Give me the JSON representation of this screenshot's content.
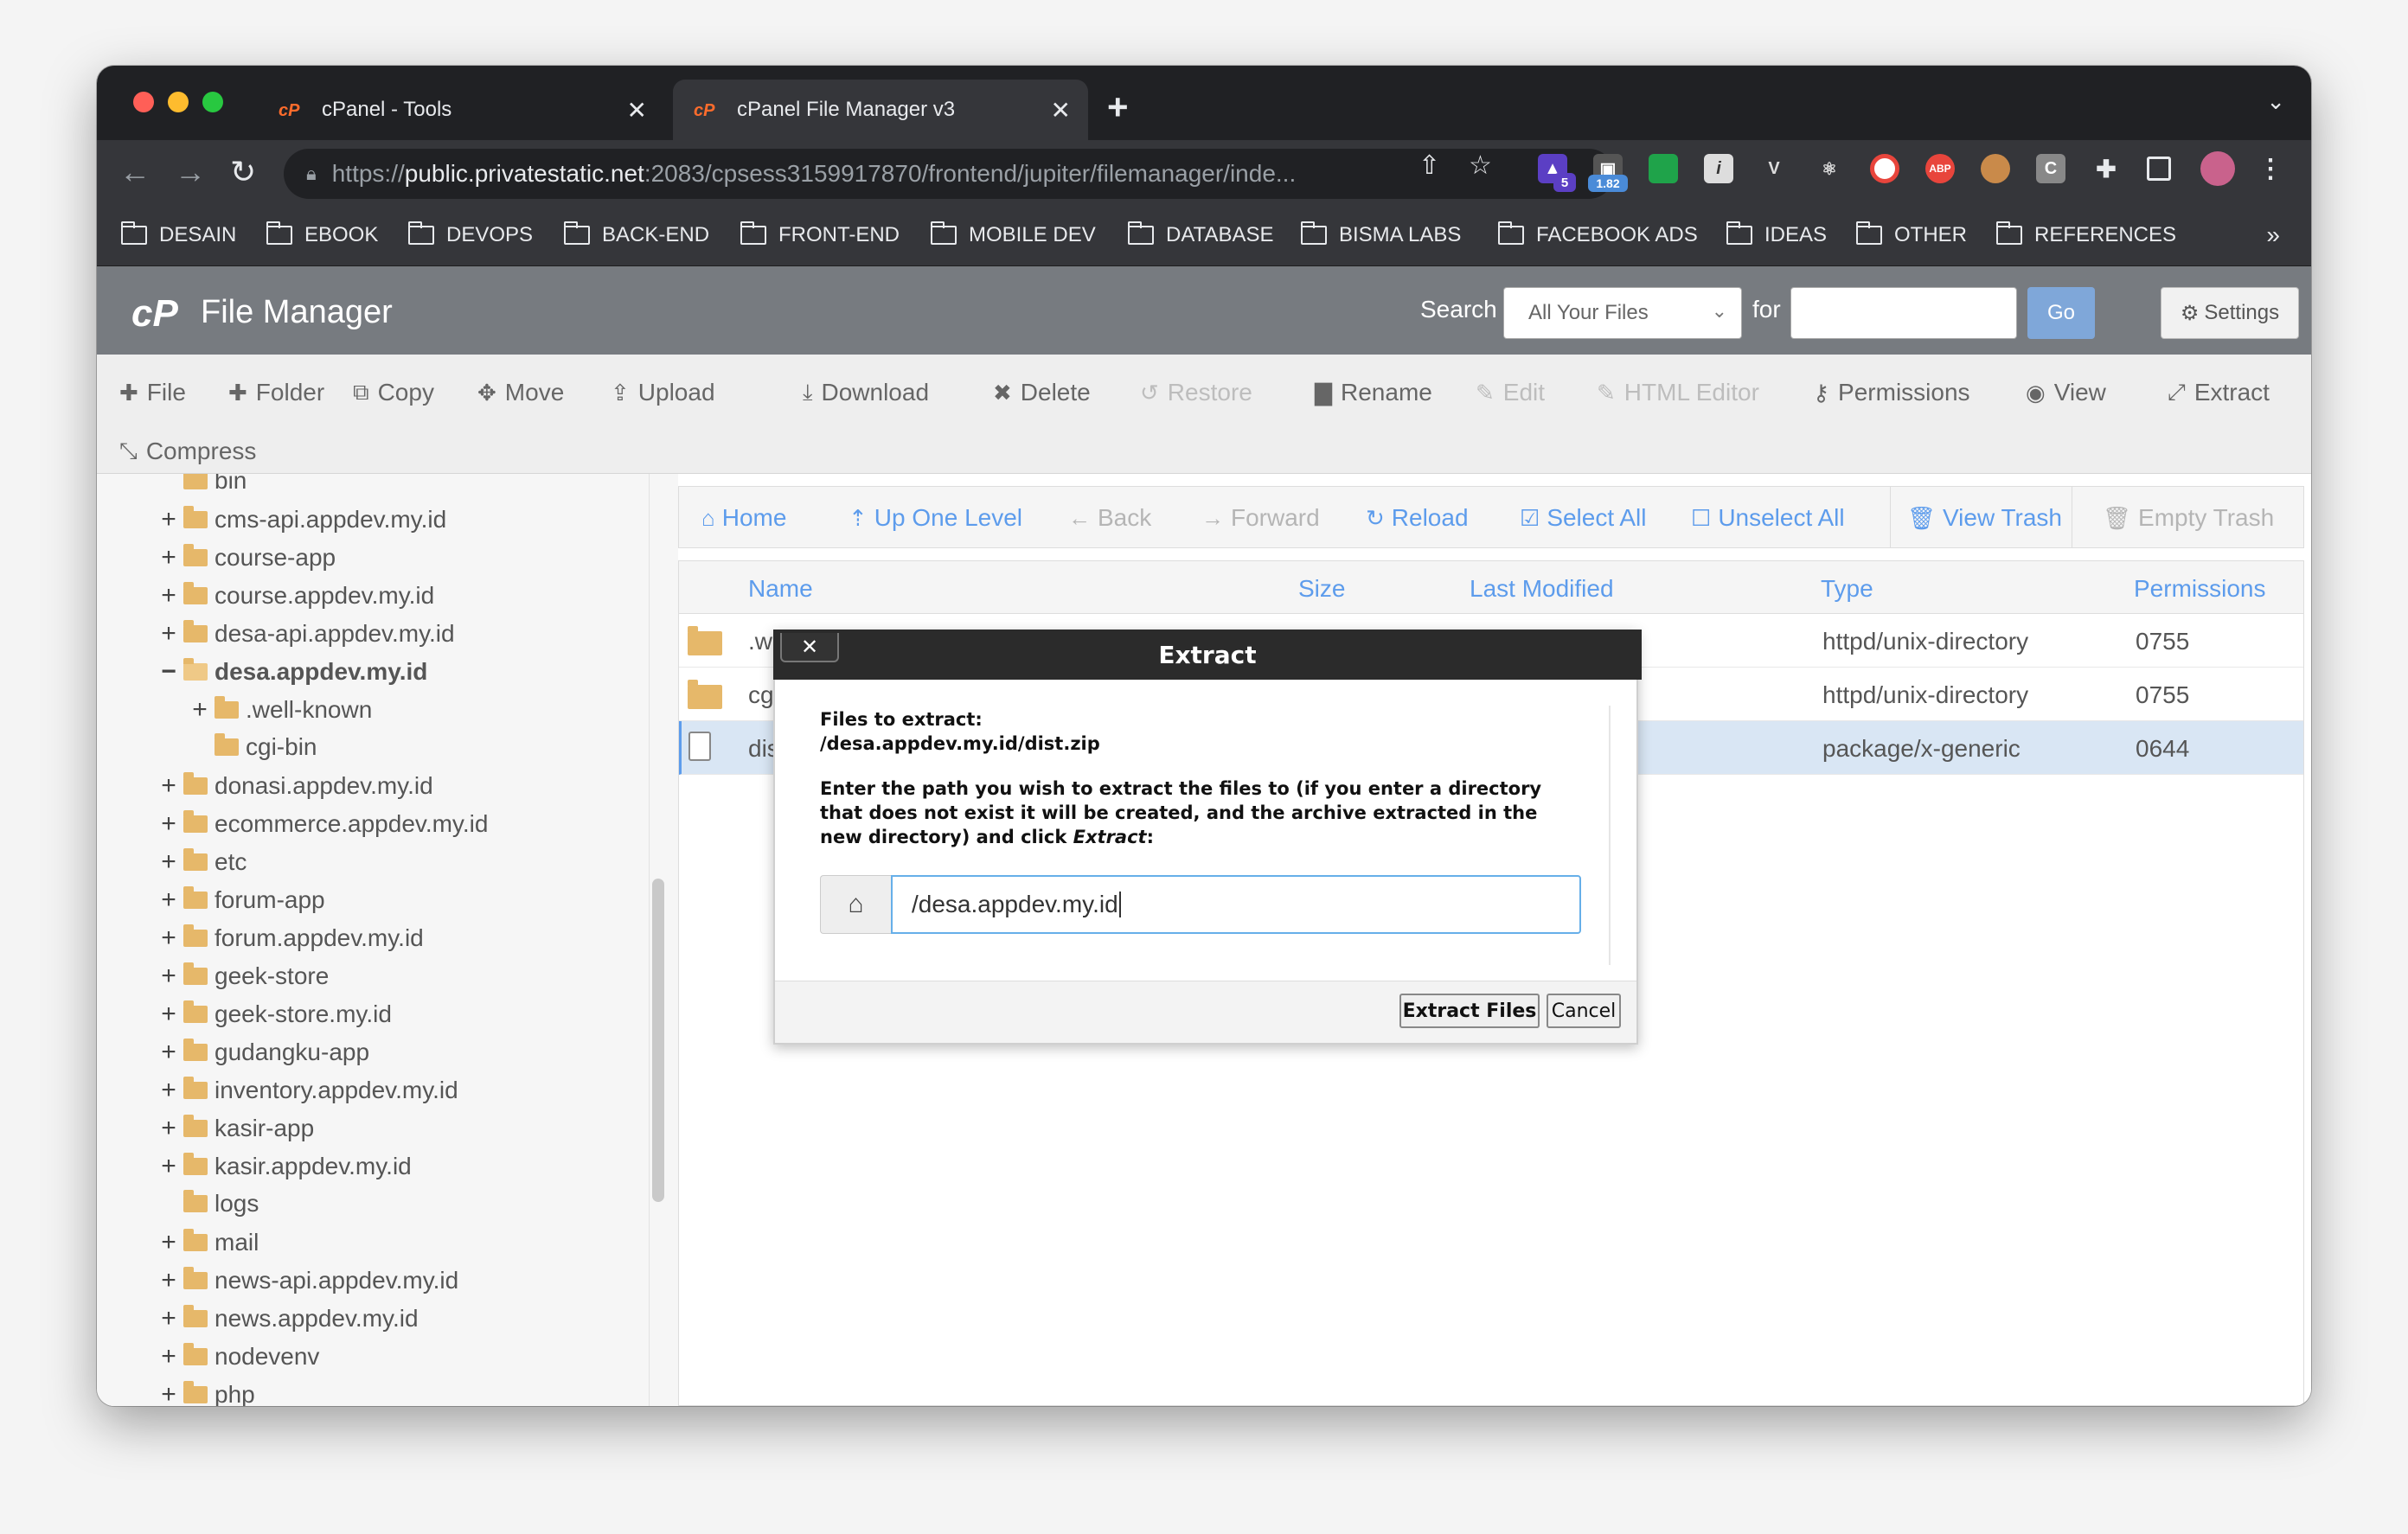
{
  "browser": {
    "tabs": [
      {
        "title": "cPanel - Tools",
        "active": false
      },
      {
        "title": "cPanel File Manager v3",
        "active": true
      }
    ],
    "url_prefix": "https://",
    "url_host": "public.privatestatic.net",
    "url_rest": ":2083/cpsess3159917870/frontend/jupiter/filemanager/inde...",
    "extension_badges": {
      "badge1": "5",
      "badge2": "1.82",
      "abp": "ABP",
      "c": "C"
    },
    "bookmarks": [
      "DESAIN",
      "EBOOK",
      "DEVOPS",
      "BACK-END",
      "FRONT-END",
      "MOBILE DEV",
      "DATABASE",
      "BISMA LABS",
      "FACEBOOK ADS",
      "IDEAS",
      "OTHER",
      "REFERENCES"
    ],
    "bookmarks_more": "»"
  },
  "cpanel": {
    "logo": "cP",
    "title": "File Manager",
    "search_label": "Search",
    "search_scope": "All Your Files",
    "for_label": "for",
    "go_label": "Go",
    "settings_label": "Settings"
  },
  "actions": {
    "file": "File",
    "folder": "Folder",
    "copy": "Copy",
    "move": "Move",
    "upload": "Upload",
    "download": "Download",
    "delete": "Delete",
    "restore": "Restore",
    "rename": "Rename",
    "edit": "Edit",
    "html_editor": "HTML Editor",
    "permissions": "Permissions",
    "view": "View",
    "extract": "Extract",
    "compress": "Compress"
  },
  "tree": [
    {
      "label": "bin",
      "expander": ""
    },
    {
      "label": "cms-api.appdev.my.id",
      "expander": "+"
    },
    {
      "label": "course-app",
      "expander": "+"
    },
    {
      "label": "course.appdev.my.id",
      "expander": "+"
    },
    {
      "label": "desa-api.appdev.my.id",
      "expander": "+"
    },
    {
      "label": "desa.appdev.my.id",
      "expander": "−"
    },
    {
      "label": ".well-known",
      "expander": "+"
    },
    {
      "label": "cgi-bin",
      "expander": ""
    },
    {
      "label": "donasi.appdev.my.id",
      "expander": "+"
    },
    {
      "label": "ecommerce.appdev.my.id",
      "expander": "+"
    },
    {
      "label": "etc",
      "expander": "+"
    },
    {
      "label": "forum-app",
      "expander": "+"
    },
    {
      "label": "forum.appdev.my.id",
      "expander": "+"
    },
    {
      "label": "geek-store",
      "expander": "+"
    },
    {
      "label": "geek-store.my.id",
      "expander": "+"
    },
    {
      "label": "gudangku-app",
      "expander": "+"
    },
    {
      "label": "inventory.appdev.my.id",
      "expander": "+"
    },
    {
      "label": "kasir-app",
      "expander": "+"
    },
    {
      "label": "kasir.appdev.my.id",
      "expander": "+"
    },
    {
      "label": "logs",
      "expander": ""
    },
    {
      "label": "mail",
      "expander": "+"
    },
    {
      "label": "news-api.appdev.my.id",
      "expander": "+"
    },
    {
      "label": "news.appdev.my.id",
      "expander": "+"
    },
    {
      "label": "nodevenv",
      "expander": "+"
    },
    {
      "label": "php",
      "expander": "+"
    }
  ],
  "nav": {
    "home": "Home",
    "up": "Up One Level",
    "back": "Back",
    "forward": "Forward",
    "reload": "Reload",
    "select_all": "Select All",
    "unselect_all": "Unselect All",
    "view_trash": "View Trash",
    "empty_trash": "Empty Trash"
  },
  "table": {
    "headers": {
      "name": "Name",
      "size": "Size",
      "modified": "Last Modified",
      "type": "Type",
      "permissions": "Permissions"
    },
    "rows": [
      {
        "name": ".well-known",
        "type": "httpd/unix-directory",
        "perm": "0755",
        "selected": false
      },
      {
        "name": "cgi-bin",
        "type": "httpd/unix-directory",
        "perm": "0755",
        "selected": false
      },
      {
        "name": "dist.zip",
        "type": "package/x-generic",
        "perm": "0644",
        "selected": true
      }
    ]
  },
  "modal": {
    "title": "Extract",
    "close": "✕",
    "files_label": "Files to extract:",
    "files_value": "/desa.appdev.my.id/dist.zip",
    "instruction_pre": "Enter the path you wish to extract the files to (if you enter a directory that does not exist it will be created, and the archive extracted in the new directory) and click ",
    "instruction_em": "Extract",
    "instruction_post": ":",
    "path_value": "/desa.appdev.my.id",
    "extract_btn": "Extract Files",
    "cancel_btn": "Cancel"
  }
}
